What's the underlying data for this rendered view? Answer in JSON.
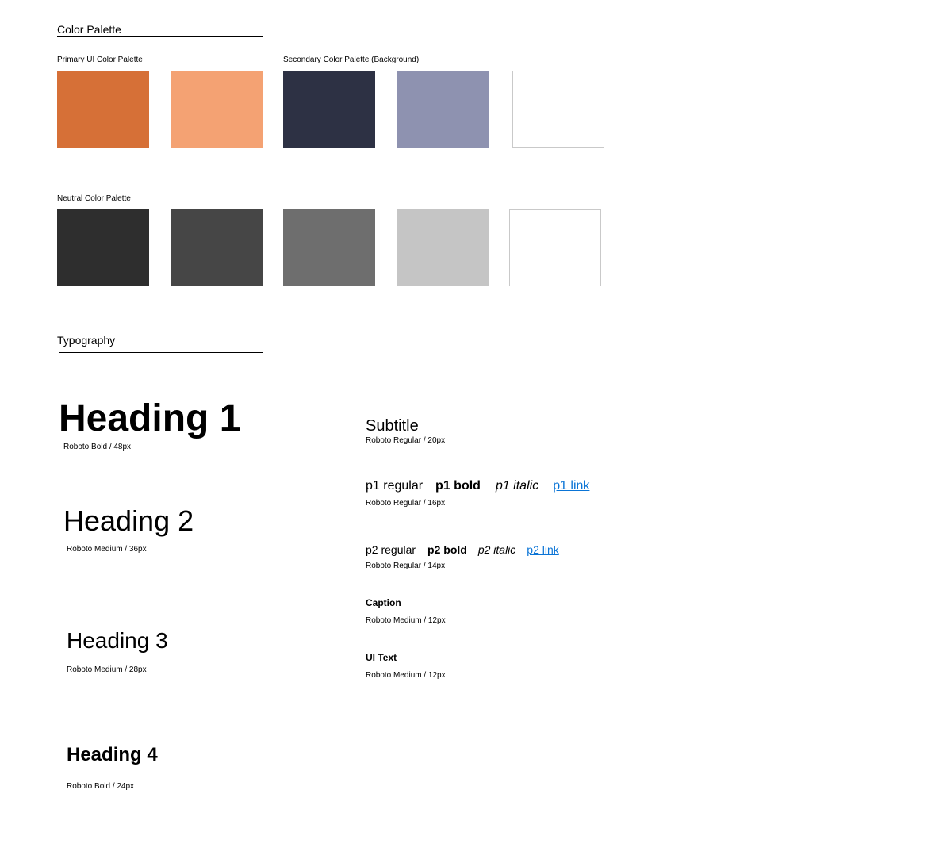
{
  "colors": {
    "primary": [
      "#D67037",
      "#F4A273"
    ],
    "secondary": [
      "#2D3144",
      "#8E92B0",
      "#FFFFFF"
    ],
    "neutral": [
      "#2E2E2E",
      "#464646",
      "#6E6E6E",
      "#C5C5C5",
      "#FFFFFF"
    ],
    "link": "#0A74D6"
  },
  "color_palette": {
    "title": "Color Palette",
    "primary_label": "Primary UI Color Palette",
    "secondary_label": "Secondary Color Palette (Background)",
    "neutral_label": "Neutral Color Palette"
  },
  "typography": {
    "title": "Typography",
    "h1": {
      "text": "Heading 1",
      "note": "Roboto Bold / 48px"
    },
    "h2": {
      "text": "Heading 2",
      "note": "Roboto Medium / 36px"
    },
    "h3": {
      "text": "Heading 3",
      "note": "Roboto Medium / 28px"
    },
    "h4": {
      "text": "Heading 4",
      "note": "Roboto Bold / 24px"
    },
    "subtitle": {
      "text": "Subtitle",
      "note": "Roboto Regular / 20px"
    },
    "p1": {
      "regular": "p1 regular",
      "bold": "p1 bold",
      "italic": "p1 italic",
      "link": "p1 link",
      "note": "Roboto Regular / 16px"
    },
    "p2": {
      "regular": "p2 regular",
      "bold": "p2 bold",
      "italic": "p2 italic",
      "link": "p2 link",
      "note": "Roboto Regular / 14px"
    },
    "caption": {
      "text": "Caption",
      "note": "Roboto Medium / 12px"
    },
    "ui_text": {
      "text": "UI Text",
      "note": "Roboto Medium / 12px"
    }
  }
}
